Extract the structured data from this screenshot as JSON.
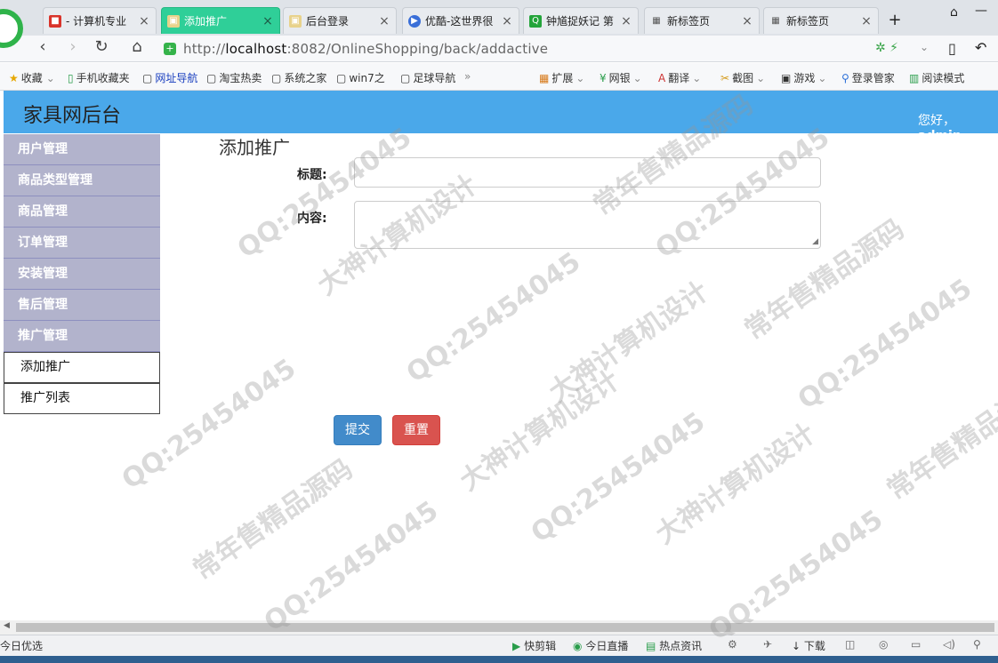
{
  "browser": {
    "tabs": [
      {
        "label": "- 计算机专业",
        "icon": "red-favicon",
        "active": false
      },
      {
        "label": "添加推广",
        "icon": "image-favicon",
        "active": true
      },
      {
        "label": "后台登录",
        "icon": "image-favicon",
        "active": false
      },
      {
        "label": "优酷-这世界很",
        "icon": "youku-favicon",
        "active": false
      },
      {
        "label": "钟馗捉妖记 第",
        "icon": "iqiyi-favicon",
        "active": false
      },
      {
        "label": "新标签页",
        "icon": "grid-favicon",
        "active": false
      },
      {
        "label": "新标签页",
        "icon": "grid-favicon",
        "active": false
      }
    ],
    "new_tab": "+",
    "url_prefix": "http://",
    "url_host": "localhost",
    "url_rest": ":8082/OnlineShopping/back/addactive",
    "bookmarks": [
      "收藏",
      "手机收藏夹",
      "网址导航",
      "淘宝热卖",
      "系统之家",
      "win7之",
      "足球导航",
      "»"
    ],
    "extensions": [
      "扩展",
      "网银",
      "翻译",
      "截图",
      "游戏",
      "登录管家",
      "阅读模式"
    ]
  },
  "app": {
    "title": "家具网后台",
    "greeting_prefix": "您好，",
    "username": "admin"
  },
  "sidebar": {
    "items": [
      {
        "label": "用户管理"
      },
      {
        "label": "商品类型管理"
      },
      {
        "label": "商品管理"
      },
      {
        "label": "订单管理"
      },
      {
        "label": "安装管理"
      },
      {
        "label": "售后管理"
      },
      {
        "label": "推广管理"
      }
    ],
    "subitems": [
      {
        "label": "添加推广"
      },
      {
        "label": "推广列表"
      }
    ]
  },
  "form": {
    "heading": "添加推广",
    "title_label": "标题:",
    "title_value": "",
    "content_label": "内容:",
    "content_value": "",
    "submit_label": "提交",
    "reset_label": "重置",
    "submit_color": "#428bca",
    "reset_color": "#d9534f"
  },
  "status": {
    "left": "今日优选",
    "items": [
      "快剪辑",
      "今日直播",
      "热点资讯",
      "下载"
    ]
  },
  "watermark": [
    "QQ:25454045",
    "常年售精品源码",
    "大神计算机设计"
  ]
}
